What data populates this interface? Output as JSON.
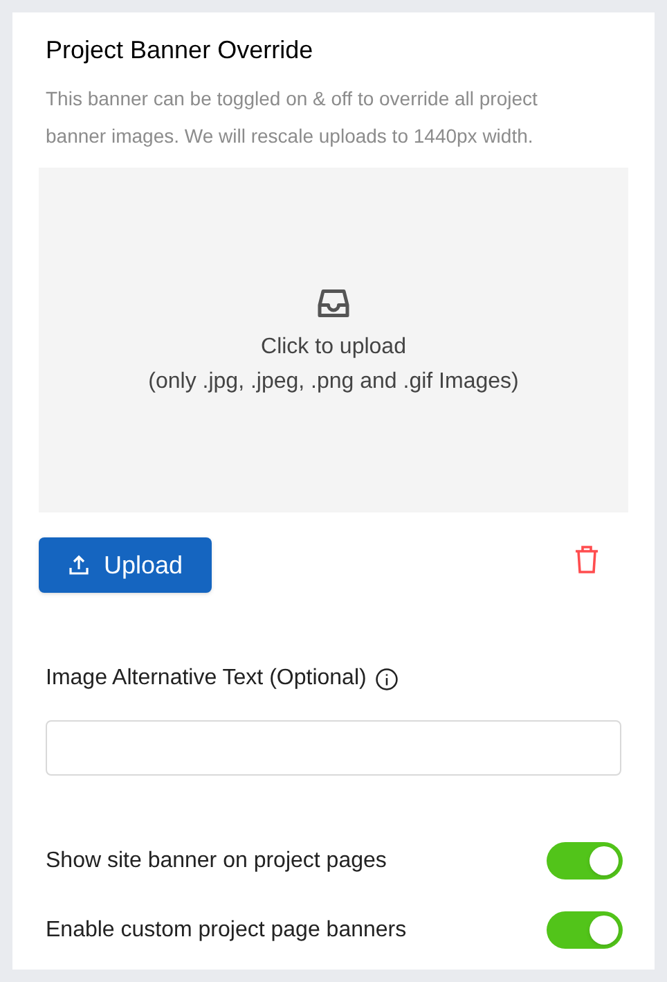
{
  "title": "Project Banner Override",
  "description": "This banner can be toggled on & off to override all project banner images. We will rescale uploads to 1440px width.",
  "dropzone": {
    "line1": "Click to upload",
    "line2": "(only .jpg, .jpeg, .png and .gif Images)"
  },
  "upload_button": "Upload",
  "alt_text": {
    "label": "Image Alternative Text (Optional)"
  },
  "toggles": [
    {
      "label": "Show site banner on project pages",
      "on": true
    },
    {
      "label": "Enable custom project page banners",
      "on": true
    }
  ]
}
